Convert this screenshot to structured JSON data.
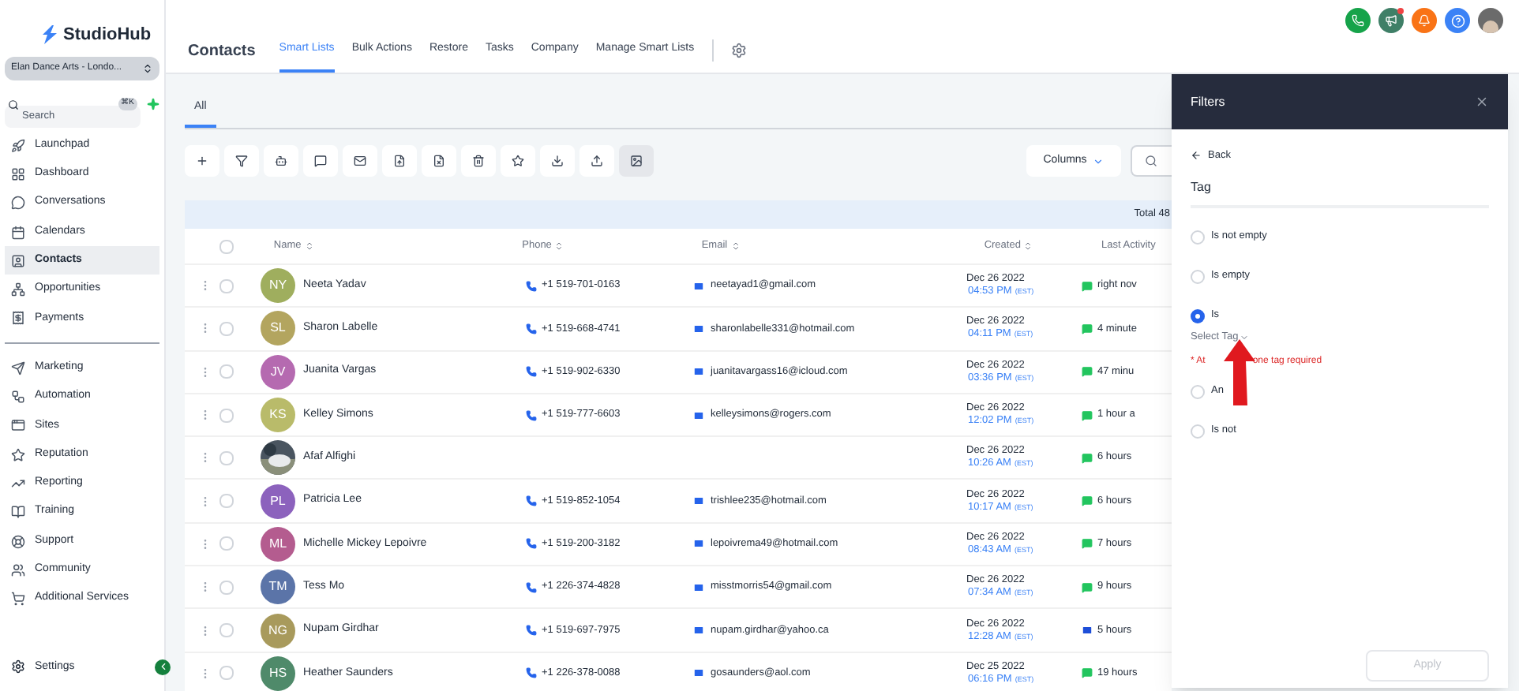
{
  "sidebar": {
    "logo": "StudioHub",
    "account": "Elan Dance Arts - Londo...",
    "search": {
      "placeholder": "Search",
      "shortcut": "⌘K"
    },
    "groups": [
      [
        {
          "label": "Launchpad",
          "selected": false
        },
        {
          "label": "Dashboard",
          "selected": false
        },
        {
          "label": "Conversations",
          "selected": false
        },
        {
          "label": "Calendars",
          "selected": false
        },
        {
          "label": "Contacts",
          "selected": true
        },
        {
          "label": "Opportunities",
          "selected": false
        },
        {
          "label": "Payments",
          "selected": false
        }
      ],
      [
        {
          "label": "Marketing",
          "selected": false
        },
        {
          "label": "Automation",
          "selected": false
        },
        {
          "label": "Sites",
          "selected": false
        },
        {
          "label": "Reputation",
          "selected": false
        },
        {
          "label": "Reporting",
          "selected": false
        },
        {
          "label": "Training",
          "selected": false
        },
        {
          "label": "Support",
          "selected": false
        },
        {
          "label": "Community",
          "selected": false
        },
        {
          "label": "Additional Services",
          "selected": false
        }
      ]
    ],
    "settings": "Settings"
  },
  "header": {
    "title": "Contacts",
    "tabs": [
      {
        "label": "Smart Lists",
        "selected": true
      },
      {
        "label": "Bulk Actions",
        "selected": false
      },
      {
        "label": "Restore",
        "selected": false
      },
      {
        "label": "Tasks",
        "selected": false
      },
      {
        "label": "Company",
        "selected": false
      },
      {
        "label": "Manage Smart Lists",
        "selected": false
      }
    ]
  },
  "list_tabs": [
    {
      "label": "All",
      "selected": true
    }
  ],
  "columns_button": "Columns",
  "total": "Total 48",
  "table": {
    "columns": [
      "Name",
      "Phone",
      "Email",
      "Created",
      "Last Activity"
    ],
    "select_all": {
      "checked": false
    },
    "rows": [
      {
        "checked": false,
        "initials": "NY",
        "color": "#9fae5e",
        "name": "Neeta Yadav",
        "phone": "+1 519-701-0163",
        "email": "neetayad1@gmail.com",
        "date": "Dec 26 2022",
        "time": "04:53 PM",
        "tz": "(EST)",
        "activity": {
          "kind": "message",
          "text": "right nov"
        }
      },
      {
        "checked": false,
        "initials": "SL",
        "color": "#b3a55f",
        "name": "Sharon Labelle",
        "phone": "+1 519-668-4741",
        "email": "sharonlabelle331@hotmail.com",
        "date": "Dec 26 2022",
        "time": "04:11 PM",
        "tz": "(EST)",
        "activity": {
          "kind": "message",
          "text": "4 minute"
        }
      },
      {
        "checked": false,
        "initials": "JV",
        "color": "#b56ab0",
        "name": "Juanita Vargas",
        "phone": "+1 519-902-6330",
        "email": "juanitavargass16@icloud.com",
        "date": "Dec 26 2022",
        "time": "03:36 PM",
        "tz": "(EST)",
        "activity": {
          "kind": "message",
          "text": "47 minu"
        }
      },
      {
        "checked": false,
        "initials": "KS",
        "color": "#b9bb6a",
        "name": "Kelley Simons",
        "phone": "+1 519-777-6603",
        "email": "kelleysimons@rogers.com",
        "date": "Dec 26 2022",
        "time": "12:02 PM",
        "tz": "(EST)",
        "activity": {
          "kind": "message",
          "text": "1 hour a"
        }
      },
      {
        "checked": false,
        "name": "Afaf Alfighi",
        "date": "Dec 26 2022",
        "time": "10:26 AM",
        "tz": "(EST)",
        "activity": {
          "kind": "message",
          "text": "6 hours"
        }
      },
      {
        "checked": false,
        "initials": "PL",
        "color": "#8c62bd",
        "name": "Patricia Lee",
        "phone": "+1 519-852-1054",
        "email": "trishlee235@hotmail.com",
        "date": "Dec 26 2022",
        "time": "10:17 AM",
        "tz": "(EST)",
        "activity": {
          "kind": "message",
          "text": "6 hours"
        }
      },
      {
        "checked": false,
        "initials": "ML",
        "color": "#b45c8f",
        "name": "Michelle Mickey Lepoivre",
        "phone": "+1 519-200-3182",
        "email": "lepoivrema49@hotmail.com",
        "date": "Dec 26 2022",
        "time": "08:43 AM",
        "tz": "(EST)",
        "activity": {
          "kind": "message",
          "text": "7 hours"
        }
      },
      {
        "checked": false,
        "initials": "TM",
        "color": "#5b74a8",
        "name": "Tess Mo",
        "phone": "+1 226-374-4828",
        "email": "misstmorris54@gmail.com",
        "date": "Dec 26 2022",
        "time": "07:34 AM",
        "tz": "(EST)",
        "activity": {
          "kind": "message",
          "text": "9 hours"
        }
      },
      {
        "checked": false,
        "initials": "NG",
        "color": "#a89a5c",
        "name": "Nupam Girdhar",
        "phone": "+1 519-697-7975",
        "email": "nupam.girdhar@yahoo.ca",
        "date": "Dec 26 2022",
        "time": "12:28 AM",
        "tz": "(EST)",
        "activity": {
          "kind": "email",
          "text": "5 hours"
        }
      },
      {
        "checked": false,
        "initials": "HS",
        "color": "#4f8a6a",
        "name": "Heather Saunders",
        "phone": "+1 226-378-0088",
        "email": "gosaunders@aol.com",
        "date": "Dec 25 2022",
        "time": "06:16 PM",
        "tz": "(EST)",
        "activity": {
          "kind": "message",
          "text": "19 hours"
        }
      }
    ]
  },
  "filters": {
    "title": "Filters",
    "back": "Back",
    "field": "Tag",
    "options": [
      {
        "label": "Is not empty",
        "selected": false
      },
      {
        "label": "Is empty",
        "selected": false
      },
      {
        "label": "Is",
        "selected": true,
        "select_placeholder": "Select Tag",
        "error": [
          "* At",
          "one tag required"
        ]
      },
      {
        "label": "An",
        "selected": false
      },
      {
        "label": "Is not",
        "selected": false
      }
    ],
    "apply": {
      "label": "Apply",
      "disabled": true
    }
  }
}
